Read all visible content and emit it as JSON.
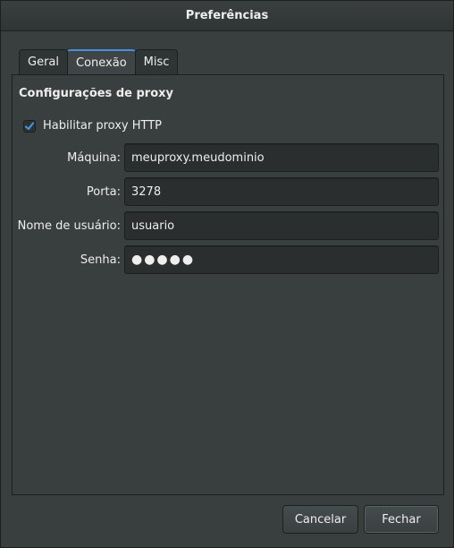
{
  "window": {
    "title": "Preferências"
  },
  "tabs": [
    {
      "label": "Geral",
      "active": false
    },
    {
      "label": "Conexão",
      "active": true
    },
    {
      "label": "Misc",
      "active": false
    }
  ],
  "proxy": {
    "section_title": "Configurações de proxy",
    "enable_label": "Habilitar proxy HTTP",
    "enabled": true,
    "fields": {
      "host": {
        "label": "Máquina:",
        "value": "meuproxy.meudominio"
      },
      "port": {
        "label": "Porta:",
        "value": "3278"
      },
      "username": {
        "label": "Nome de usuário:",
        "value": "usuario"
      },
      "password": {
        "label": "Senha:",
        "value": "●●●●●"
      }
    }
  },
  "buttons": {
    "cancel": "Cancelar",
    "close": "Fechar"
  },
  "colors": {
    "accent": "#4a90d9",
    "background": "#393f3f"
  }
}
